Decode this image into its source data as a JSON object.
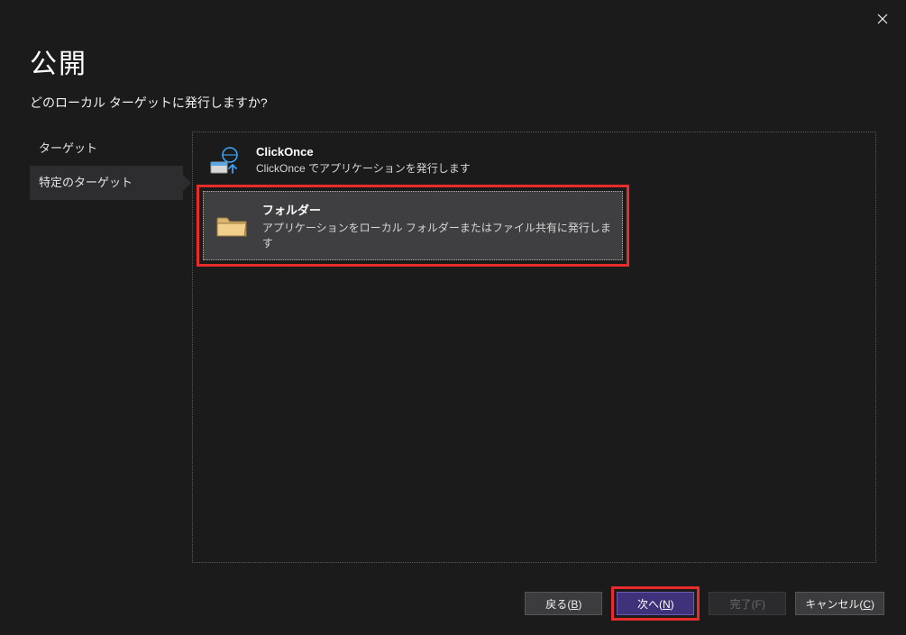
{
  "window": {
    "title": "公開",
    "subtitle": "どのローカル ターゲットに発行しますか?"
  },
  "sidebar": {
    "items": [
      {
        "label": "ターゲット",
        "active": false
      },
      {
        "label": "特定のターゲット",
        "active": true
      }
    ]
  },
  "options": [
    {
      "title": "ClickOnce",
      "desc": "ClickOnce でアプリケーションを発行します",
      "selected": false,
      "icon": "clickonce-icon"
    },
    {
      "title": "フォルダー",
      "desc": "アプリケーションをローカル フォルダーまたはファイル共有に発行します",
      "selected": true,
      "icon": "folder-icon"
    }
  ],
  "footer": {
    "back": {
      "label": "戻る",
      "accel": "B"
    },
    "next": {
      "label": "次へ",
      "accel": "N"
    },
    "finish": {
      "label": "完了",
      "accel": "F"
    },
    "cancel": {
      "label": "キャンセル",
      "accel": "C"
    }
  }
}
